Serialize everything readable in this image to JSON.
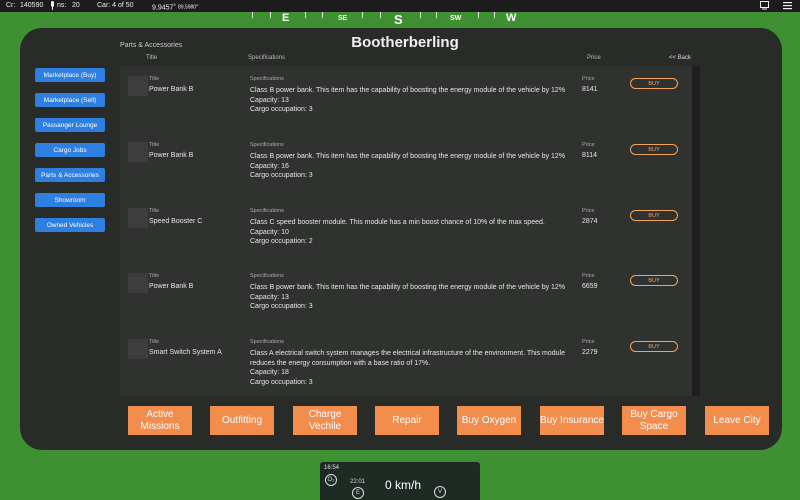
{
  "topbar": {
    "credits_label": "Cr:",
    "credits": "140590",
    "missions_label": "ns:",
    "missions": "20",
    "car": "Car: 4 of 50",
    "coords": "9,9457",
    "coords_sup": "3",
    "coords_small": "89,5980",
    "coords_small_sup": "w"
  },
  "compass": {
    "e": "E",
    "se": "SE",
    "s": "S",
    "sw": "SW",
    "w": "W"
  },
  "title": "Bootherberling",
  "breadcrumb": "Parts & Accessories",
  "headers": {
    "title": "Title",
    "specifications": "Specifications",
    "price": "Price",
    "back": "<< Back"
  },
  "sidebar": [
    "Marketplace (Buy)",
    "Marketplace (Sell)",
    "Passanger Lounge",
    "Cargo Jobs",
    "Parts & Accessories",
    "Showroom",
    "Owned Vehicles"
  ],
  "labels": {
    "title": "Title",
    "specifications": "Specifications",
    "price": "Price",
    "buy": "BUY"
  },
  "items": [
    {
      "title": "Power Bank B",
      "spec": "Class B power bank. This item has the capability of boosting the energy module of the vehicle by 12%",
      "capacity": "Capacity: 13",
      "cargo": "Cargo occupation: 3",
      "price": "8141"
    },
    {
      "title": "Power Bank B",
      "spec": "Class B power bank. This item has the capability of boosting the energy module of the vehicle by 12%",
      "capacity": "Capacity: 16",
      "cargo": "Cargo occupation: 3",
      "price": "8114"
    },
    {
      "title": "Speed Booster C",
      "spec": "Class C speed booster module. This module has a min boost chance of 10% of the max speed.",
      "capacity": "Capacity: 10",
      "cargo": "Cargo occupation: 2",
      "price": "2874"
    },
    {
      "title": "Power Bank B",
      "spec": "Class B power bank. This item has the capability of boosting the energy module of the vehicle by 12%",
      "capacity": "Capacity: 13",
      "cargo": "Cargo occupation: 3",
      "price": "6659"
    },
    {
      "title": "Smart Switch System A",
      "spec": "Class A electrical switch system manages the electrical infrastructure of the environment. This module reduces the energy consumption with a base ratio of 17%.",
      "capacity": "Capacity: 18",
      "cargo": "Cargo occupation: 3",
      "price": "2279"
    }
  ],
  "actions": [
    "Active Missions",
    "Outfitting",
    "Charge Vechile",
    "Repair",
    "Buy Oxygen",
    "Buy Insurance",
    "Buy Cargo Space",
    "Leave City"
  ],
  "hud": {
    "time": "16:54",
    "o2": "O₂",
    "e_time": "22:01",
    "e": "E",
    "speed": "0 km/h",
    "v": "V"
  },
  "colors": {
    "accent": "#2f7fe0",
    "action": "#f28d4d",
    "buy": "#f2a45a",
    "bg": "#3f8f33"
  }
}
